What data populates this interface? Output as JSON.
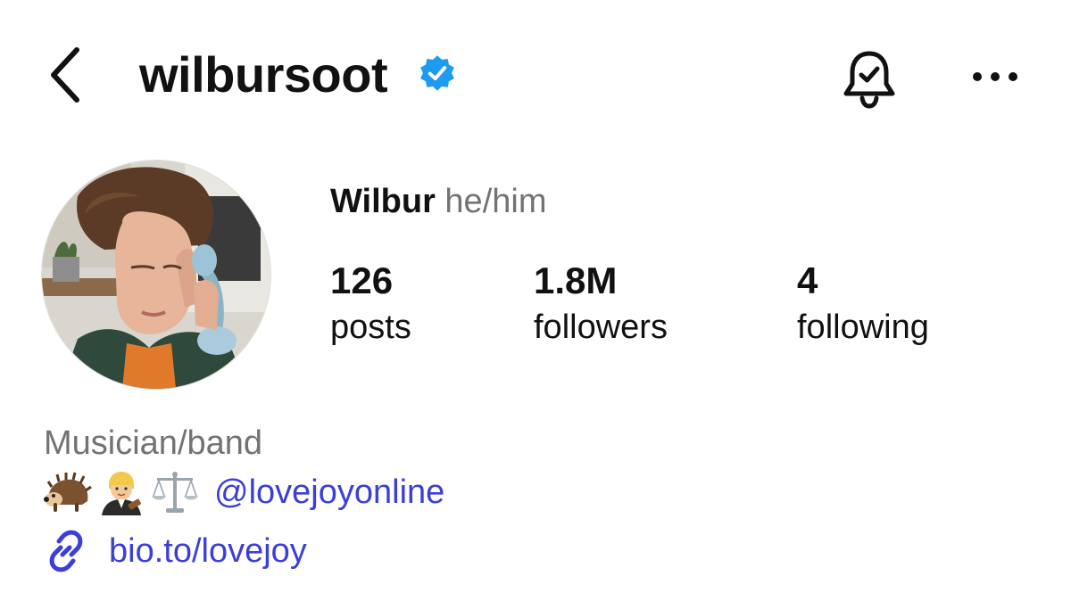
{
  "header": {
    "username": "wilbursoot",
    "verified": true,
    "icons": {
      "back": "chevron-left-icon",
      "verified": "verified-badge-icon",
      "notifications": "bell-check-icon",
      "more": "more-horizontal-icon"
    }
  },
  "profile": {
    "display_name": "Wilbur",
    "pronouns": "he/him",
    "stats": {
      "posts": {
        "value": "126",
        "label": "posts"
      },
      "followers": {
        "value": "1.8M",
        "label": "followers"
      },
      "following": {
        "value": "4",
        "label": "following"
      }
    },
    "category": "Musician/band",
    "bio": {
      "emojis": [
        "hedgehog-emoji",
        "judge-emoji",
        "scales-emoji"
      ],
      "mention": "@lovejoyonline"
    },
    "link": "bio.to/lovejoy"
  },
  "colors": {
    "text": "#111111",
    "muted": "#737373",
    "link": "#3b3fd8",
    "verified": "#1d9bf0"
  }
}
